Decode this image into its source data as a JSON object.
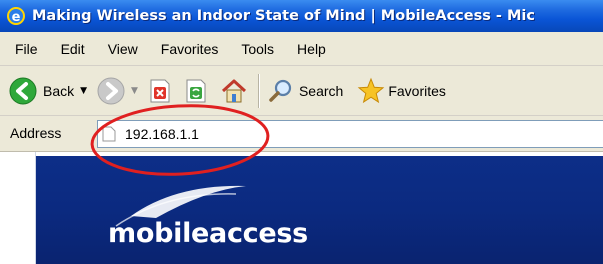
{
  "window": {
    "title": "Making Wireless an Indoor State of Mind | MobileAccess - Mic"
  },
  "menubar": {
    "items": [
      "File",
      "Edit",
      "View",
      "Favorites",
      "Tools",
      "Help"
    ]
  },
  "toolbar": {
    "back_label": "Back",
    "search_label": "Search",
    "favorites_label": "Favorites"
  },
  "addressbar": {
    "label": "Address",
    "value": "192.168.1.1"
  },
  "page": {
    "logo_text": "mobileaccess"
  },
  "colors": {
    "titlebar": "#0a55d6",
    "chrome": "#ece9d8",
    "banner": "#0b2a80",
    "highlight_ellipse": "#e02020"
  },
  "icons": [
    "ie-logo-icon",
    "back-arrow-icon",
    "forward-arrow-icon",
    "stop-icon",
    "refresh-icon",
    "home-icon",
    "search-magnifier-icon",
    "favorites-star-icon",
    "page-icon"
  ]
}
